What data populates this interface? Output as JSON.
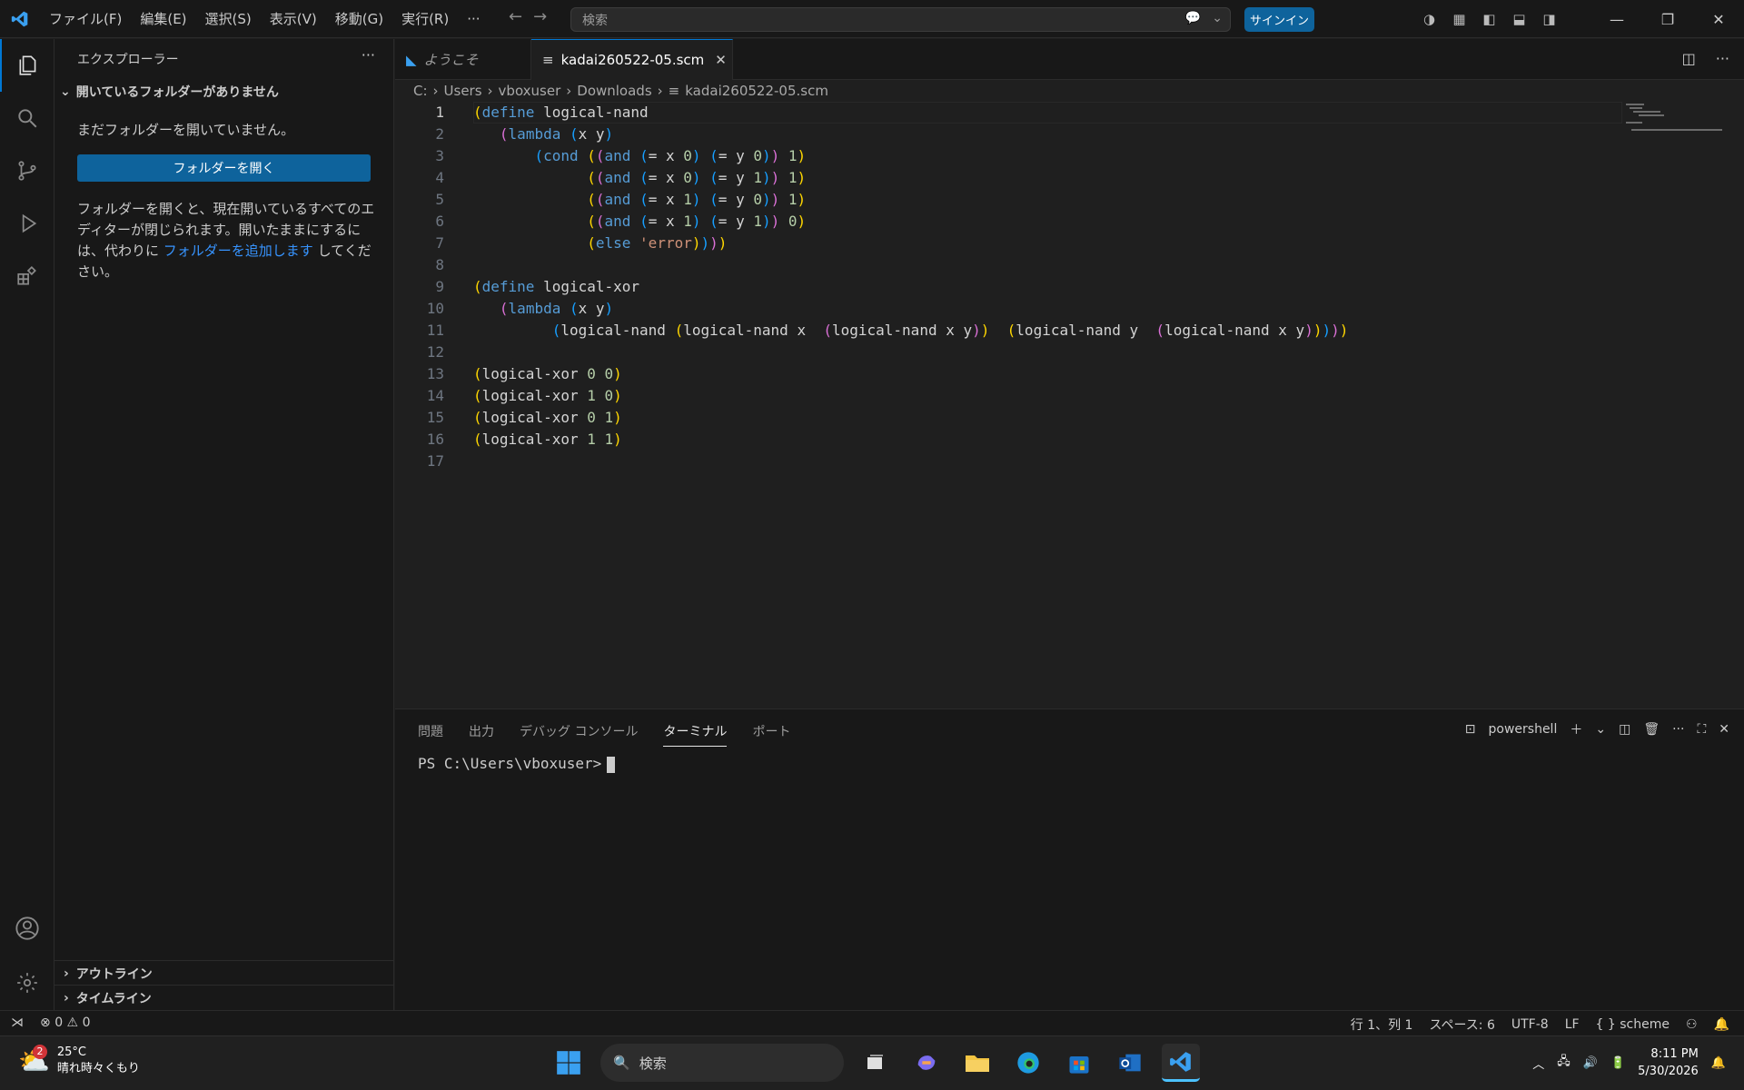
{
  "titlebar": {
    "menus": [
      "ファイル(F)",
      "編集(E)",
      "選択(S)",
      "表示(V)",
      "移動(G)",
      "実行(R)",
      "···"
    ],
    "search_placeholder": "検索",
    "signin": "サインイン"
  },
  "sidebar": {
    "title": "エクスプローラー",
    "section": "開いているフォルダーがありません",
    "message": "まだフォルダーを開いていません。",
    "open_button": "フォルダーを開く",
    "desc_part1": "フォルダーを開くと、現在開いているすべてのエディターが閉じられます。開いたままにするには、代わりに",
    "desc_link": "フォルダーを追加します",
    "desc_part2": "してください。",
    "outline": "アウトライン",
    "timeline": "タイムライン"
  },
  "tabs": [
    {
      "label": "ようこそ"
    },
    {
      "label": "kadai260522-05.scm"
    }
  ],
  "breadcrumb": [
    "C:",
    "Users",
    "vboxuser",
    "Downloads",
    "kadai260522-05.scm"
  ],
  "editor": {
    "lines": [
      "1",
      "2",
      "3",
      "4",
      "5",
      "6",
      "7",
      "8",
      "9",
      "10",
      "11",
      "12",
      "13",
      "14",
      "15",
      "16",
      "17"
    ]
  },
  "panel": {
    "tabs": [
      "問題",
      "出力",
      "デバッグ コンソール",
      "ターミナル",
      "ポート"
    ],
    "shell": "powershell",
    "prompt": "PS C:\\Users\\vboxuser>"
  },
  "statusbar": {
    "errors": "0",
    "warnings": "0",
    "position": "行 1、列 1",
    "spaces": "スペース: 6",
    "encoding": "UTF-8",
    "eol": "LF",
    "language": "scheme"
  },
  "taskbar": {
    "temp": "25°C",
    "weather": "晴れ時々くもり",
    "badge": "2",
    "search": "検索",
    "time": "8:11 PM",
    "date": "5/30/2026"
  }
}
